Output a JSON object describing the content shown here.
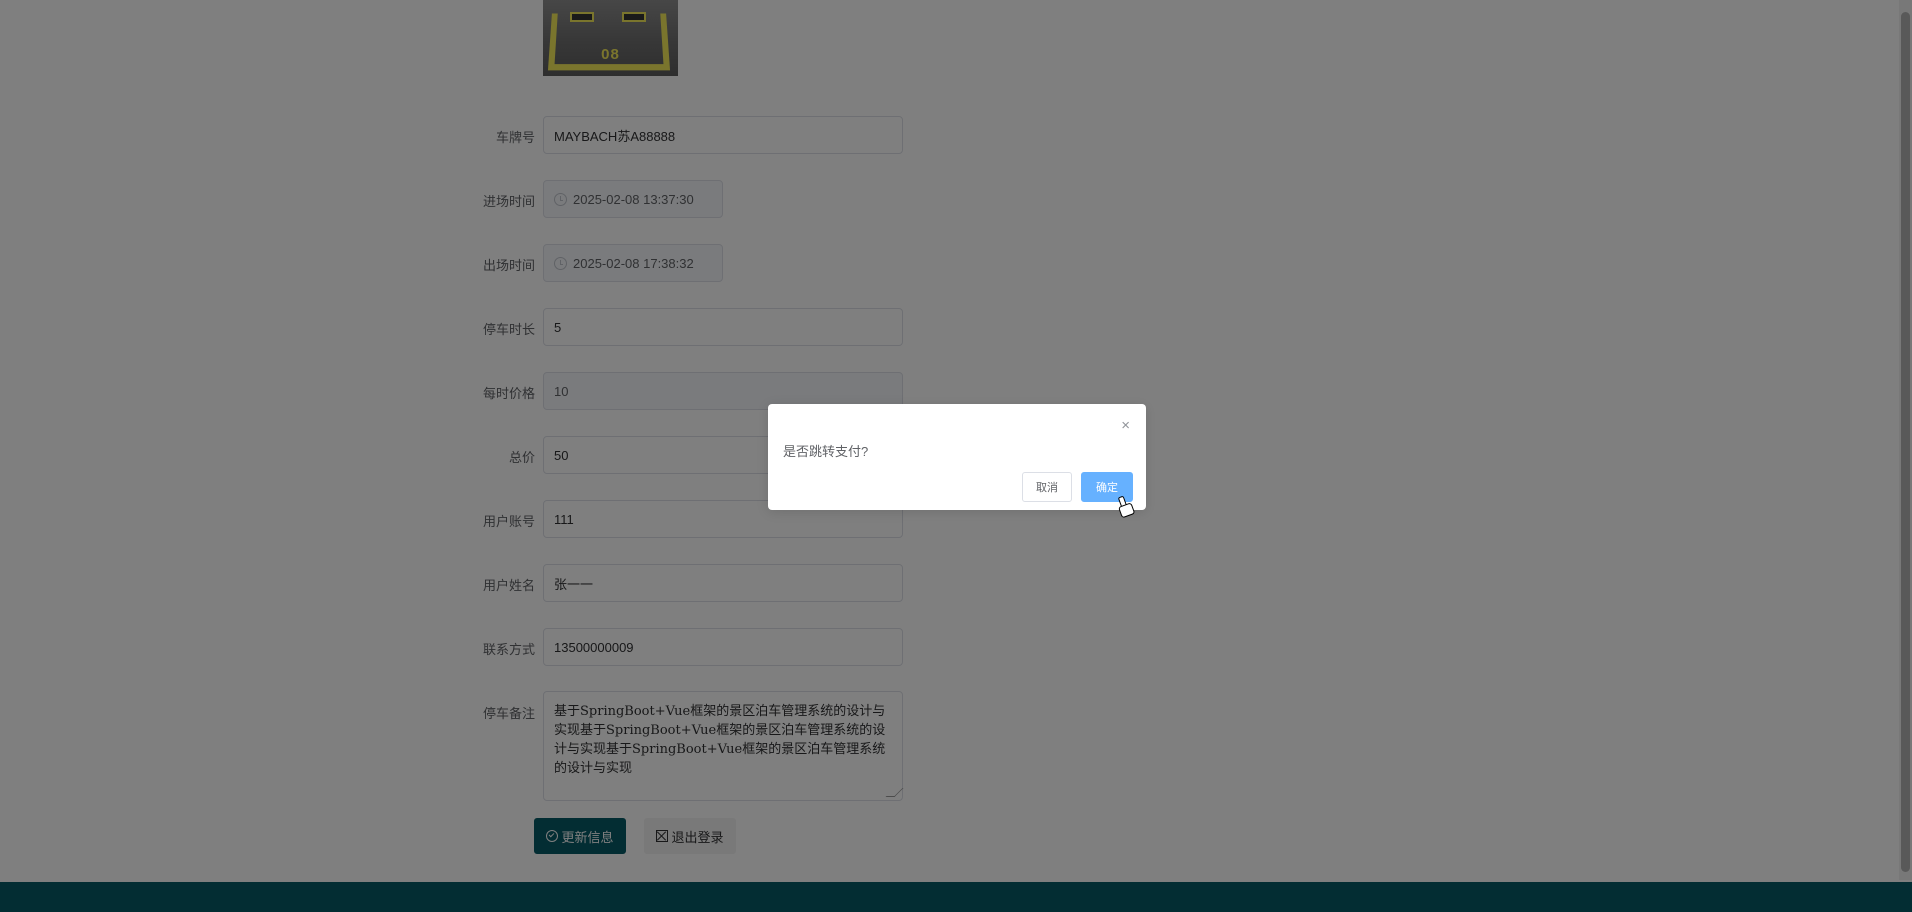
{
  "form": {
    "photo": {
      "spot_number": "08"
    },
    "fields": [
      {
        "label": "车牌号",
        "value": "MAYBACH苏A88888"
      },
      {
        "label": "进场时间",
        "value": "2025-02-08 13:37:30"
      },
      {
        "label": "出场时间",
        "value": "2025-02-08 17:38:32"
      },
      {
        "label": "停车时长",
        "value": "5"
      },
      {
        "label": "每时价格",
        "value": "10"
      },
      {
        "label": "总价",
        "value": "50"
      },
      {
        "label": "用户账号",
        "value": "111"
      },
      {
        "label": "用户姓名",
        "value": "张一一"
      },
      {
        "label": "联系方式",
        "value": "13500000009"
      }
    ],
    "notes": {
      "label": "停车备注",
      "value": "基于SpringBoot+Vue框架的景区泊车管理系统的设计与实现基于SpringBoot+Vue框架的景区泊车管理系统的设计与实现基于SpringBoot+Vue框架的景区泊车管理系统的设计与实现"
    },
    "buttons": {
      "update": "更新信息",
      "logout": "退出登录"
    }
  },
  "dialog": {
    "message": "是否跳转支付?",
    "close_icon": "×",
    "cancel": "取消",
    "confirm": "确定"
  },
  "colors": {
    "primary": "#075a67",
    "confirm": "#66b1ff",
    "mask": "rgba(0,0,0,0.5)"
  }
}
